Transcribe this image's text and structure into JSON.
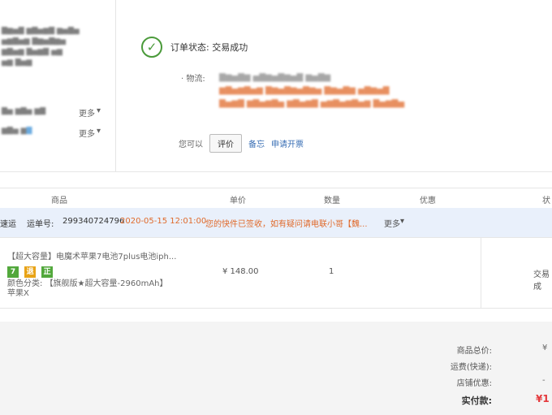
{
  "status": {
    "label": "订单状态:",
    "value": "交易成功",
    "icon": "check-circle-icon",
    "color": "#4a9a3a"
  },
  "logistics": {
    "label": "· 物流:"
  },
  "actions": {
    "prefix": "您可以",
    "evaluate": "评价",
    "memo": "备忘",
    "invoice": "申请开票"
  },
  "sidebar": {
    "more1": "更多",
    "more2": "更多"
  },
  "table": {
    "headers": [
      "商品",
      "单价",
      "数量",
      "优惠",
      "状"
    ]
  },
  "shipping": {
    "carrier": "速运",
    "tracking_label": "运单号:",
    "tracking_no": "299340724796",
    "time": "2020-05-15 12:01:00",
    "message": "您的快件已签收，如有疑问请电联小哥【魏...",
    "more": "更多"
  },
  "item": {
    "title": "【超大容量】电魔术苹果7电池7plus电池iph...",
    "badges": [
      "7",
      "退",
      "正"
    ],
    "attr_label": "颜色分类:",
    "attr_value": "【旗舰版★超大容量-2960mAh】",
    "attr_extra": "苹果X",
    "price": "¥ 148.00",
    "qty": "1",
    "status": "交易成"
  },
  "summary": {
    "goods_total_label": "商品总价:",
    "goods_total_value": "¥",
    "shipping_label": "运费(快递):",
    "discount_label": "店铺优惠:",
    "discount_value": "-",
    "paid_label": "实付款:",
    "paid_value": "¥1"
  },
  "colors": {
    "orange": "#e06a2b",
    "link": "#3a6fb5",
    "paid": "#e4393c",
    "badge_green": "#52a83c",
    "badge_orange": "#e8a317"
  }
}
